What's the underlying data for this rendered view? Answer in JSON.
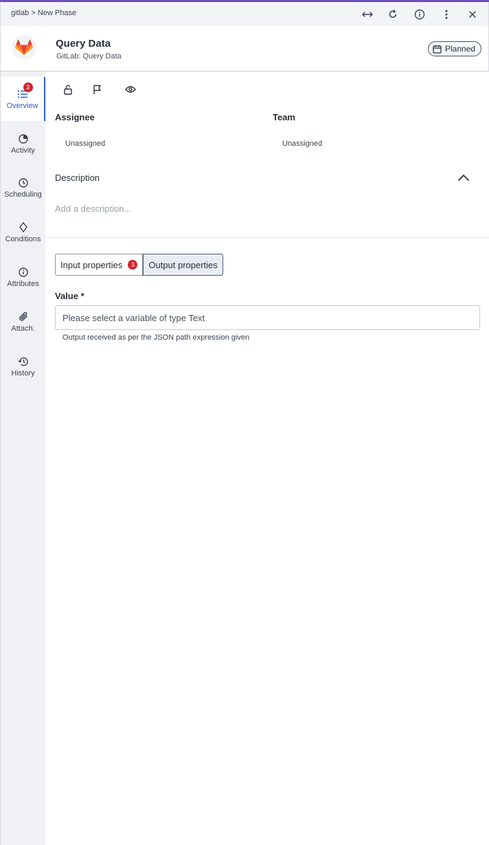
{
  "titlebar": {
    "breadcrumb": "gitlab > New Phase",
    "icons": [
      "expand-horizontal-icon",
      "refresh-icon",
      "info-icon",
      "more-vertical-icon",
      "close-icon"
    ]
  },
  "header": {
    "title": "Query Data",
    "subtitle": "GitLab: Query Data",
    "status_label": "Planned",
    "brand_color": "#fc6d26"
  },
  "sidebar": {
    "items": [
      {
        "label": "Overview",
        "icon": "list-icon",
        "badge": "3",
        "active": true
      },
      {
        "label": "Activity",
        "icon": "pie-chart-icon"
      },
      {
        "label": "Scheduling",
        "icon": "clock-icon"
      },
      {
        "label": "Conditions",
        "icon": "diamond-icon"
      },
      {
        "label": "Attributes",
        "icon": "info-icon"
      },
      {
        "label": "Attach.",
        "icon": "paperclip-icon"
      },
      {
        "label": "History",
        "icon": "history-icon"
      }
    ]
  },
  "actions": [
    "unlock-icon",
    "flag-icon",
    "eye-icon"
  ],
  "fields": {
    "assignee_label": "Assignee",
    "assignee_value": "Unassigned",
    "team_label": "Team",
    "team_value": "Unassigned"
  },
  "description": {
    "label": "Description",
    "placeholder": "Add a description..."
  },
  "tabs": {
    "input_label": "Input properties",
    "input_badge": "3",
    "output_label": "Output properties",
    "selected": "output"
  },
  "output": {
    "value_label": "Value *",
    "value_placeholder": "Please select a variable of type Text",
    "helper_text": "Output received as per the JSON path expression given"
  },
  "colors": {
    "accent": "#6b4fbb",
    "active_nav": "#2d5bd1",
    "badge": "#d1232a"
  }
}
